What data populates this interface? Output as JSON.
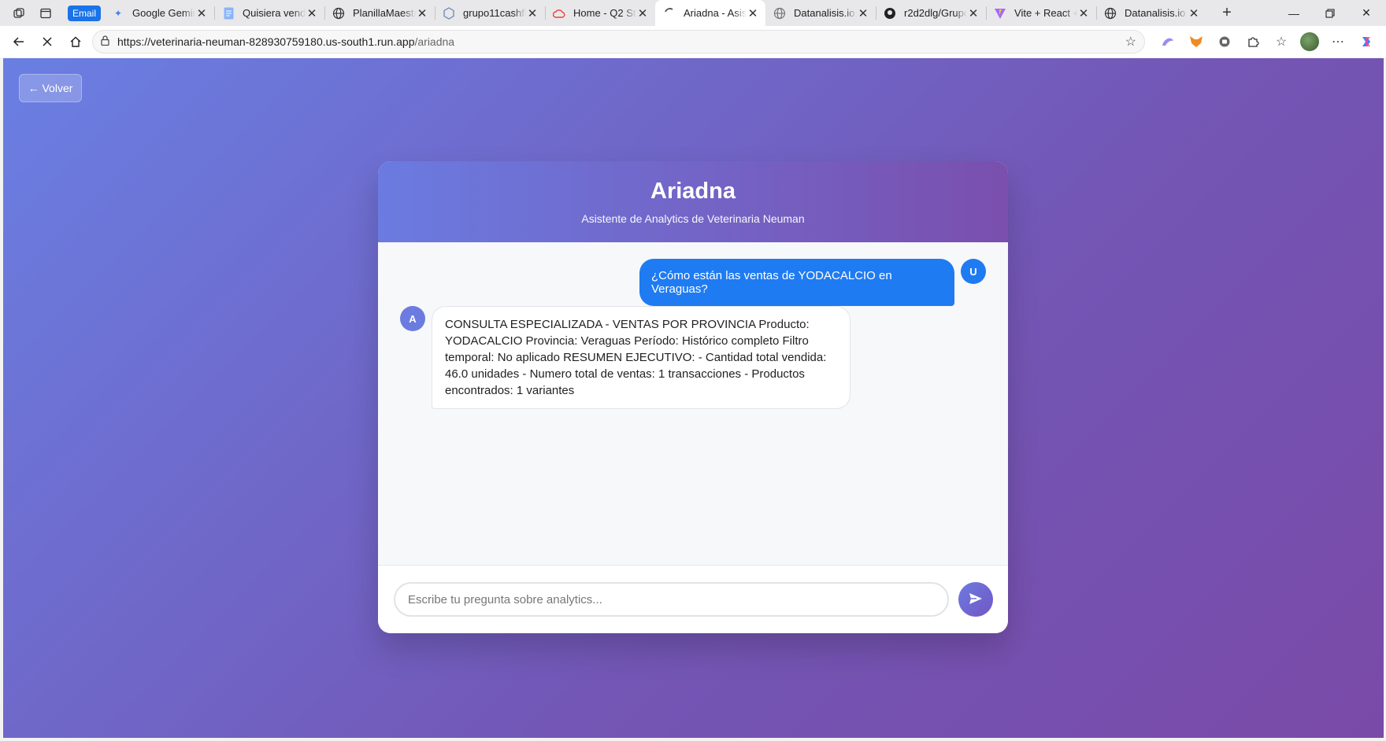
{
  "browser": {
    "email_badge": "Email",
    "tabs": [
      {
        "title": "Google Gemini",
        "icon": "gemini-icon",
        "active": false
      },
      {
        "title": "Quisiera vender",
        "icon": "document-icon",
        "active": false
      },
      {
        "title": "PlanillaMaestra",
        "icon": "globe-icon",
        "active": false
      },
      {
        "title": "grupo11cashflow",
        "icon": "cube-icon",
        "active": false
      },
      {
        "title": "Home - Q2 Stat",
        "icon": "cloud-icon",
        "active": false
      },
      {
        "title": "Ariadna - Asiste",
        "icon": "loading-icon",
        "active": true
      },
      {
        "title": "Datanalisis.io -",
        "icon": "globe-icon",
        "active": false
      },
      {
        "title": "r2d2dlg/Grupo",
        "icon": "github-icon",
        "active": false
      },
      {
        "title": "Vite + React +",
        "icon": "vite-icon",
        "active": false
      },
      {
        "title": "Datanalisis.io -",
        "icon": "globe-icon",
        "active": false
      }
    ],
    "url_host": "https://veterinaria-neuman-828930759180.us-south1.run.app",
    "url_path": "/ariadna"
  },
  "page": {
    "back_label": "← Volver",
    "chat": {
      "title": "Ariadna",
      "subtitle": "Asistente de Analytics de Veterinaria Neuman",
      "user_avatar": "U",
      "bot_avatar": "A",
      "messages": [
        {
          "role": "user",
          "text": "¿Cómo están las ventas de YODACALCIO en Veraguas?"
        },
        {
          "role": "bot",
          "text": "CONSULTA ESPECIALIZADA - VENTAS POR PROVINCIA Producto: YODACALCIO Provincia: Veraguas Período: Histórico completo Filtro temporal: No aplicado RESUMEN EJECUTIVO: - Cantidad total vendida: 46.0 unidades - Numero total de ventas: 1 transacciones - Productos encontrados: 1 variantes"
        }
      ],
      "input_placeholder": "Escribe tu pregunta sobre analytics...",
      "input_value": ""
    }
  },
  "colors": {
    "user_bubble": "#1f7bf2",
    "accent_start": "#6b7be0",
    "accent_end": "#7a4fae"
  }
}
